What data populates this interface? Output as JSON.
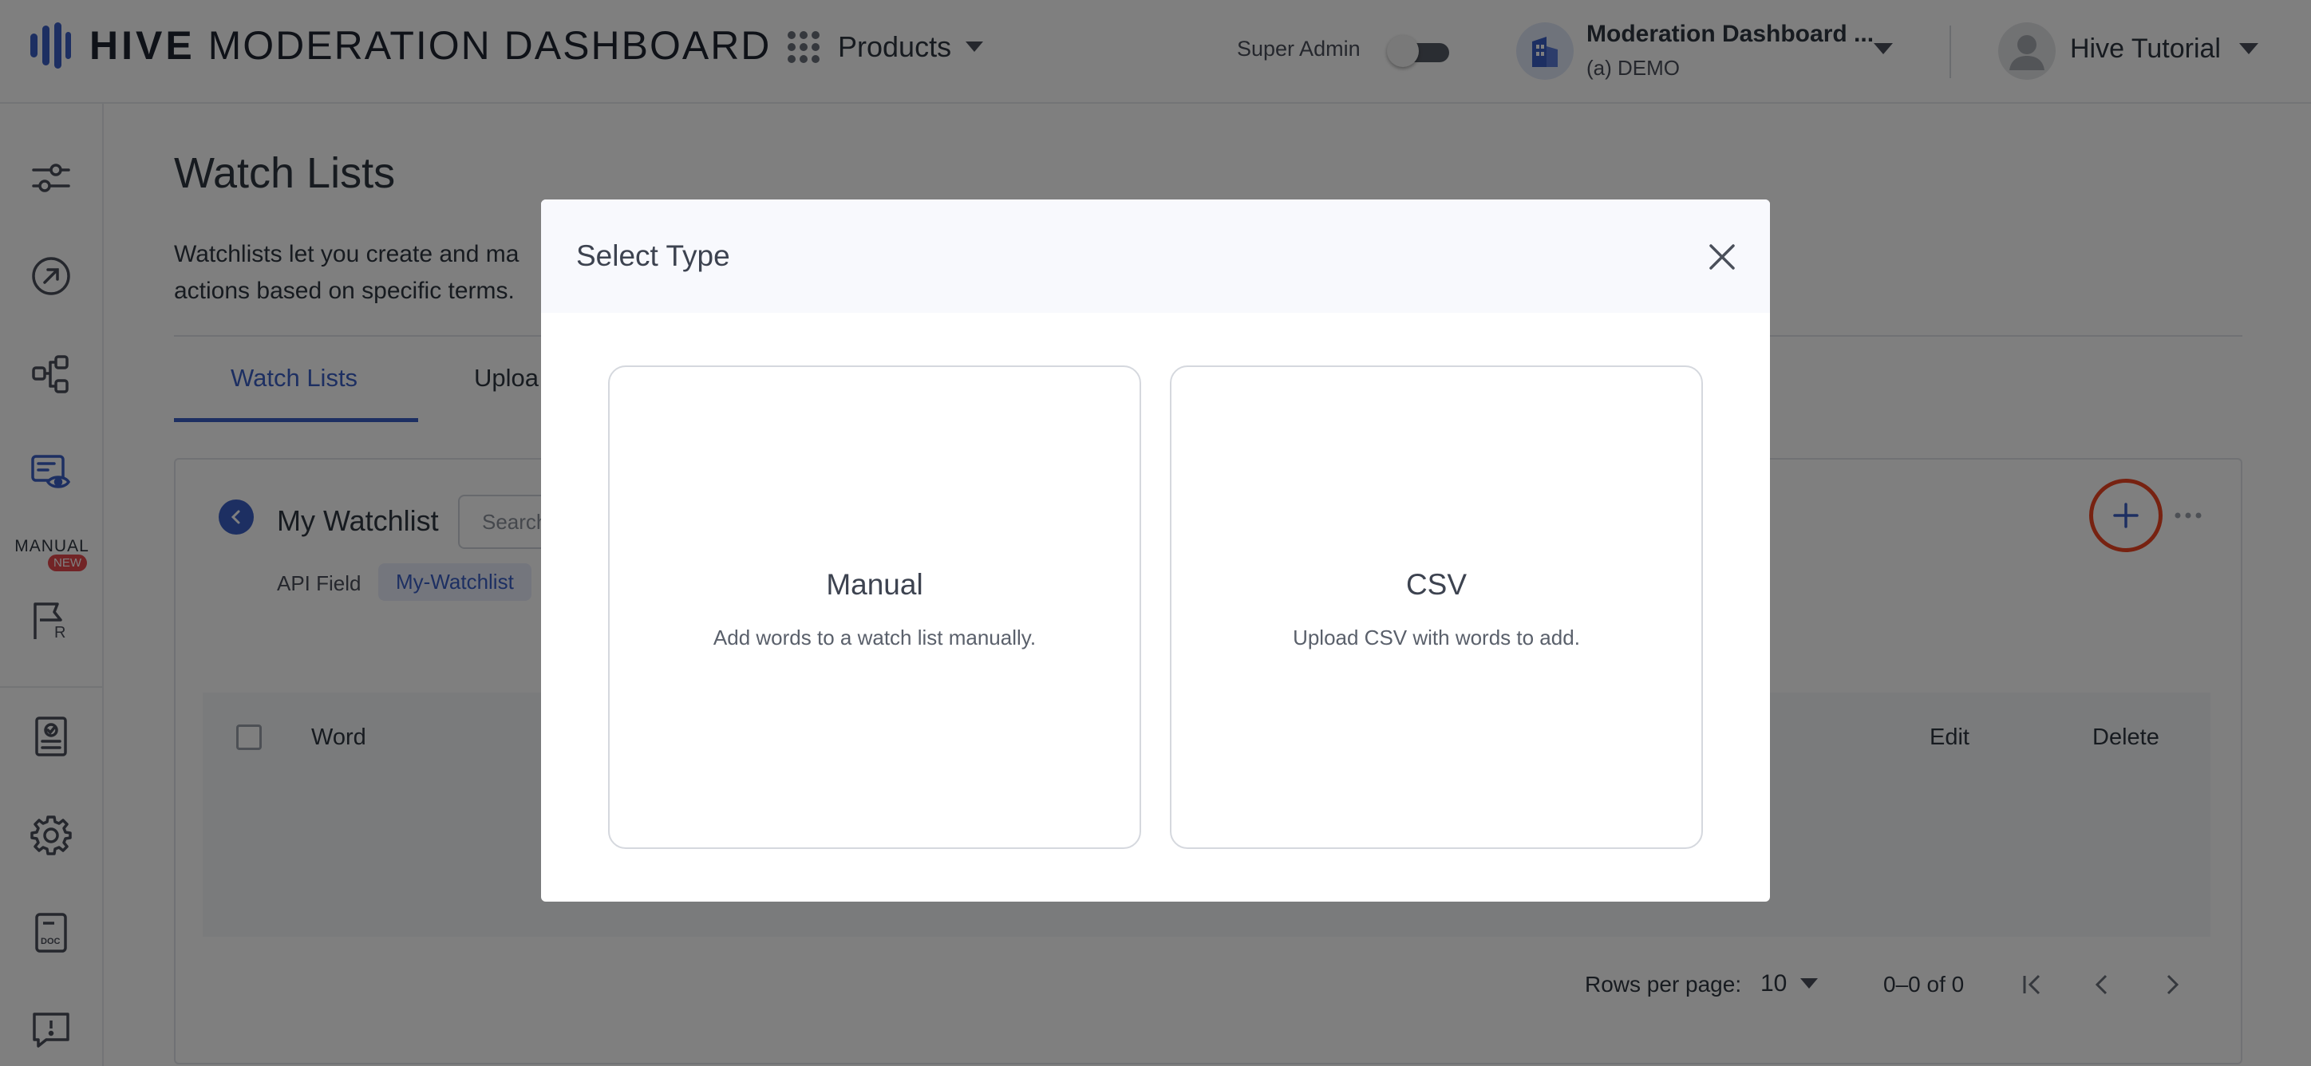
{
  "header": {
    "brand_bold": "HIVE",
    "brand_rest": "MODERATION DASHBOARD",
    "products_label": "Products",
    "super_admin_label": "Super Admin",
    "org_name": "Moderation Dashboard ...",
    "org_sub": "(a) DEMO",
    "user_name": "Hive Tutorial"
  },
  "sidebar": {
    "manual_label": "MANUAL",
    "new_badge": "NEW",
    "icons": [
      "sliders-icon",
      "trend-arrow-icon",
      "workflow-icon",
      "watchlist-eye-icon",
      "flag-review-icon",
      "report-icon",
      "gear-icon",
      "doc-icon",
      "feedback-icon"
    ]
  },
  "page": {
    "title": "Watch Lists",
    "description": "Watchlists let you create and ma actions based on specific terms.",
    "description_line1": "Watchlists let you create and ma",
    "description_line2": "actions based on specific terms.",
    "tabs": [
      {
        "label": "Watch Lists",
        "active": true
      },
      {
        "label": "Uploa",
        "active": false
      }
    ]
  },
  "watchlist": {
    "name": "My Watchlist",
    "search_placeholder": "Search",
    "api_field_label": "API Field",
    "api_field_value": "My-Watchlist"
  },
  "table": {
    "columns": [
      "Word",
      "Edit",
      "Delete"
    ]
  },
  "pagination": {
    "rows_per_page_label": "Rows per page:",
    "rows_per_page_value": "10",
    "range": "0–0 of 0"
  },
  "modal": {
    "title": "Select Type",
    "options": [
      {
        "title": "Manual",
        "description": "Add words to a watch list manually."
      },
      {
        "title": "CSV",
        "description": "Upload CSV with words to add."
      }
    ]
  },
  "colors": {
    "accent": "#3a5fc4",
    "highlight_ring": "#ef4523",
    "badge": "#e5484d"
  }
}
